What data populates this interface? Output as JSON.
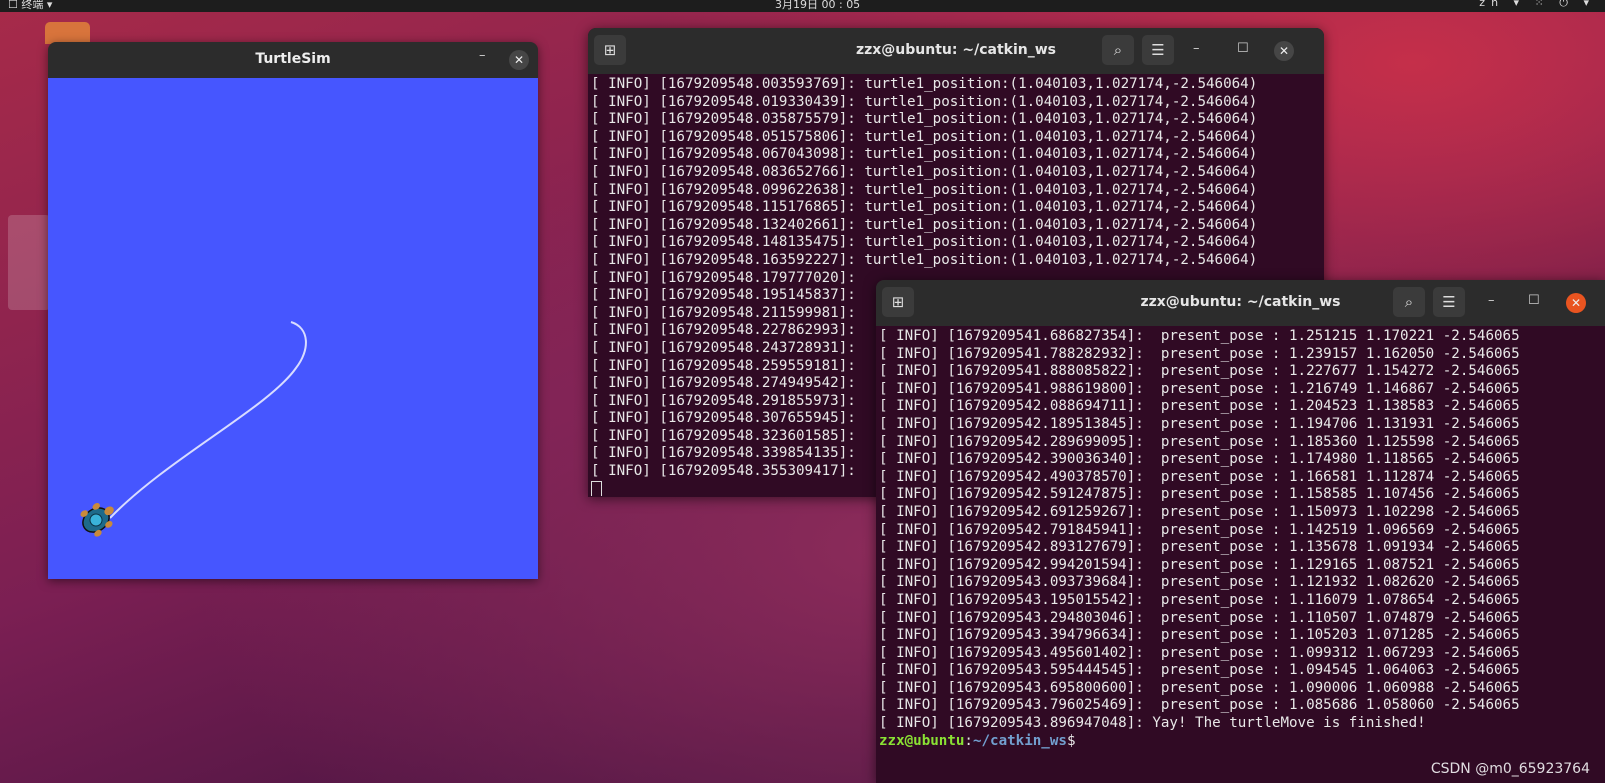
{
  "topbar": {
    "left": "☐ 终端 ▾",
    "clock": "3月19日 00 : 05",
    "right": "zh ▾  ⁙  ⏻ ▾"
  },
  "turtlesim": {
    "title": "TurtleSim",
    "minimize": "–",
    "close": "✕",
    "canvas_color": "#4656ff"
  },
  "term1": {
    "title": "zzx@ubuntu: ~/catkin_ws",
    "lines": [
      "[ INFO] [1679209548.003593769]: turtle1_position:(1.040103,1.027174,-2.546064)",
      "[ INFO] [1679209548.019330439]: turtle1_position:(1.040103,1.027174,-2.546064)",
      "[ INFO] [1679209548.035875579]: turtle1_position:(1.040103,1.027174,-2.546064)",
      "[ INFO] [1679209548.051575806]: turtle1_position:(1.040103,1.027174,-2.546064)",
      "[ INFO] [1679209548.067043098]: turtle1_position:(1.040103,1.027174,-2.546064)",
      "[ INFO] [1679209548.083652766]: turtle1_position:(1.040103,1.027174,-2.546064)",
      "[ INFO] [1679209548.099622638]: turtle1_position:(1.040103,1.027174,-2.546064)",
      "[ INFO] [1679209548.115176865]: turtle1_position:(1.040103,1.027174,-2.546064)",
      "[ INFO] [1679209548.132402661]: turtle1_position:(1.040103,1.027174,-2.546064)",
      "[ INFO] [1679209548.148135475]: turtle1_position:(1.040103,1.027174,-2.546064)",
      "[ INFO] [1679209548.163592227]: turtle1_position:(1.040103,1.027174,-2.546064)",
      "[ INFO] [1679209548.179777020]:",
      "[ INFO] [1679209548.195145837]:",
      "[ INFO] [1679209548.211599981]:",
      "[ INFO] [1679209548.227862993]:",
      "[ INFO] [1679209548.243728931]:",
      "[ INFO] [1679209548.259559181]:",
      "[ INFO] [1679209548.274949542]:",
      "[ INFO] [1679209548.291855973]:",
      "[ INFO] [1679209548.307655945]:",
      "[ INFO] [1679209548.323601585]:",
      "[ INFO] [1679209548.339854135]:",
      "[ INFO] [1679209548.355309417]:"
    ]
  },
  "term2": {
    "title": "zzx@ubuntu: ~/catkin_ws",
    "lines": [
      "[ INFO] [1679209541.686827354]:  present_pose : 1.251215 1.170221 -2.546065",
      "[ INFO] [1679209541.788282932]:  present_pose : 1.239157 1.162050 -2.546065",
      "[ INFO] [1679209541.888085822]:  present_pose : 1.227677 1.154272 -2.546065",
      "[ INFO] [1679209541.988619800]:  present_pose : 1.216749 1.146867 -2.546065",
      "[ INFO] [1679209542.088694711]:  present_pose : 1.204523 1.138583 -2.546065",
      "[ INFO] [1679209542.189513845]:  present_pose : 1.194706 1.131931 -2.546065",
      "[ INFO] [1679209542.289699095]:  present_pose : 1.185360 1.125598 -2.546065",
      "[ INFO] [1679209542.390036340]:  present_pose : 1.174980 1.118565 -2.546065",
      "[ INFO] [1679209542.490378570]:  present_pose : 1.166581 1.112874 -2.546065",
      "[ INFO] [1679209542.591247875]:  present_pose : 1.158585 1.107456 -2.546065",
      "[ INFO] [1679209542.691259267]:  present_pose : 1.150973 1.102298 -2.546065",
      "[ INFO] [1679209542.791845941]:  present_pose : 1.142519 1.096569 -2.546065",
      "[ INFO] [1679209542.893127679]:  present_pose : 1.135678 1.091934 -2.546065",
      "[ INFO] [1679209542.994201594]:  present_pose : 1.129165 1.087521 -2.546065",
      "[ INFO] [1679209543.093739684]:  present_pose : 1.121932 1.082620 -2.546065",
      "[ INFO] [1679209543.195015542]:  present_pose : 1.116079 1.078654 -2.546065",
      "[ INFO] [1679209543.294803046]:  present_pose : 1.110507 1.074879 -2.546065",
      "[ INFO] [1679209543.394796634]:  present_pose : 1.105203 1.071285 -2.546065",
      "[ INFO] [1679209543.495601402]:  present_pose : 1.099312 1.067293 -2.546065",
      "[ INFO] [1679209543.595444545]:  present_pose : 1.094545 1.064063 -2.546065",
      "[ INFO] [1679209543.695800600]:  present_pose : 1.090006 1.060988 -2.546065",
      "[ INFO] [1679209543.796025469]:  present_pose : 1.085686 1.058060 -2.546065",
      "[ INFO] [1679209543.896947048]: Yay! The turtleMove is finished!"
    ],
    "prompt_user": "zzx@ubuntu",
    "prompt_sep": ":",
    "prompt_path": "~/catkin_ws",
    "prompt_end": "$"
  },
  "icons": {
    "new_tab": "new-tab-icon",
    "search": "search-icon",
    "menu": "hamburger-menu-icon",
    "minimize": "minimize-icon",
    "maximize": "maximize-icon",
    "close": "close-icon"
  },
  "colors": {
    "terminal_bg": "#300a24",
    "close_active": "#e95420",
    "prompt_user": "#8ae234",
    "prompt_path": "#729fcf"
  },
  "watermark": "CSDN @m0_65923764"
}
